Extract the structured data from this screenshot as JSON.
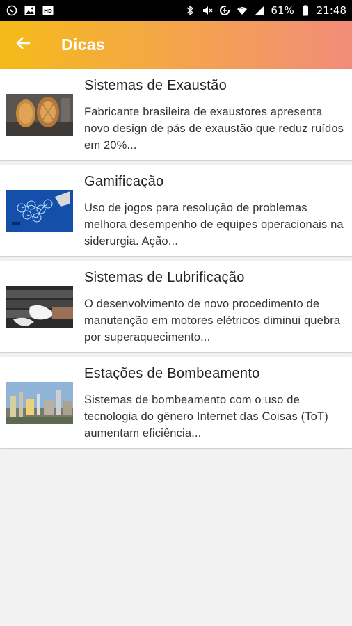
{
  "status_bar": {
    "battery": "61%",
    "time": "21:48",
    "left_icons": [
      "whatsapp-icon",
      "image-icon",
      "hd-icon"
    ],
    "right_icons": [
      "bluetooth-icon",
      "mute-icon",
      "data-saver-icon",
      "wifi-icon",
      "signal-icon",
      "battery-icon"
    ]
  },
  "app_bar": {
    "title": "Dicas",
    "back_icon": "arrow-left-icon",
    "gradient": [
      "#f5bb19",
      "#f4a746",
      "#f28c7a"
    ]
  },
  "items": [
    {
      "title": "Sistemas de Exaustão",
      "description": "Fabricante brasileira de exaustores apresenta novo design de pás de exaustão que reduz ruídos em 20%...",
      "image": "exhaust-fans-photo"
    },
    {
      "title": "Gamificação",
      "description": "Uso de jogos para resolução de problemas melhora desempenho de equipes operacionais na siderurgia. Ação...",
      "image": "network-hexagon-photo"
    },
    {
      "title": "Sistemas de Lubrificação",
      "description": "O desenvolvimento de novo procedimento de manutenção em motores elétricos diminui quebra por superaquecimento...",
      "image": "gloved-hand-pipes-photo"
    },
    {
      "title": "Estações de Bombeamento",
      "description": "Sistemas de bombeamento com o uso de tecnologia do gênero Internet das Coisas (ToT) aumentam eficiência...",
      "image": "industrial-plant-photo"
    }
  ]
}
